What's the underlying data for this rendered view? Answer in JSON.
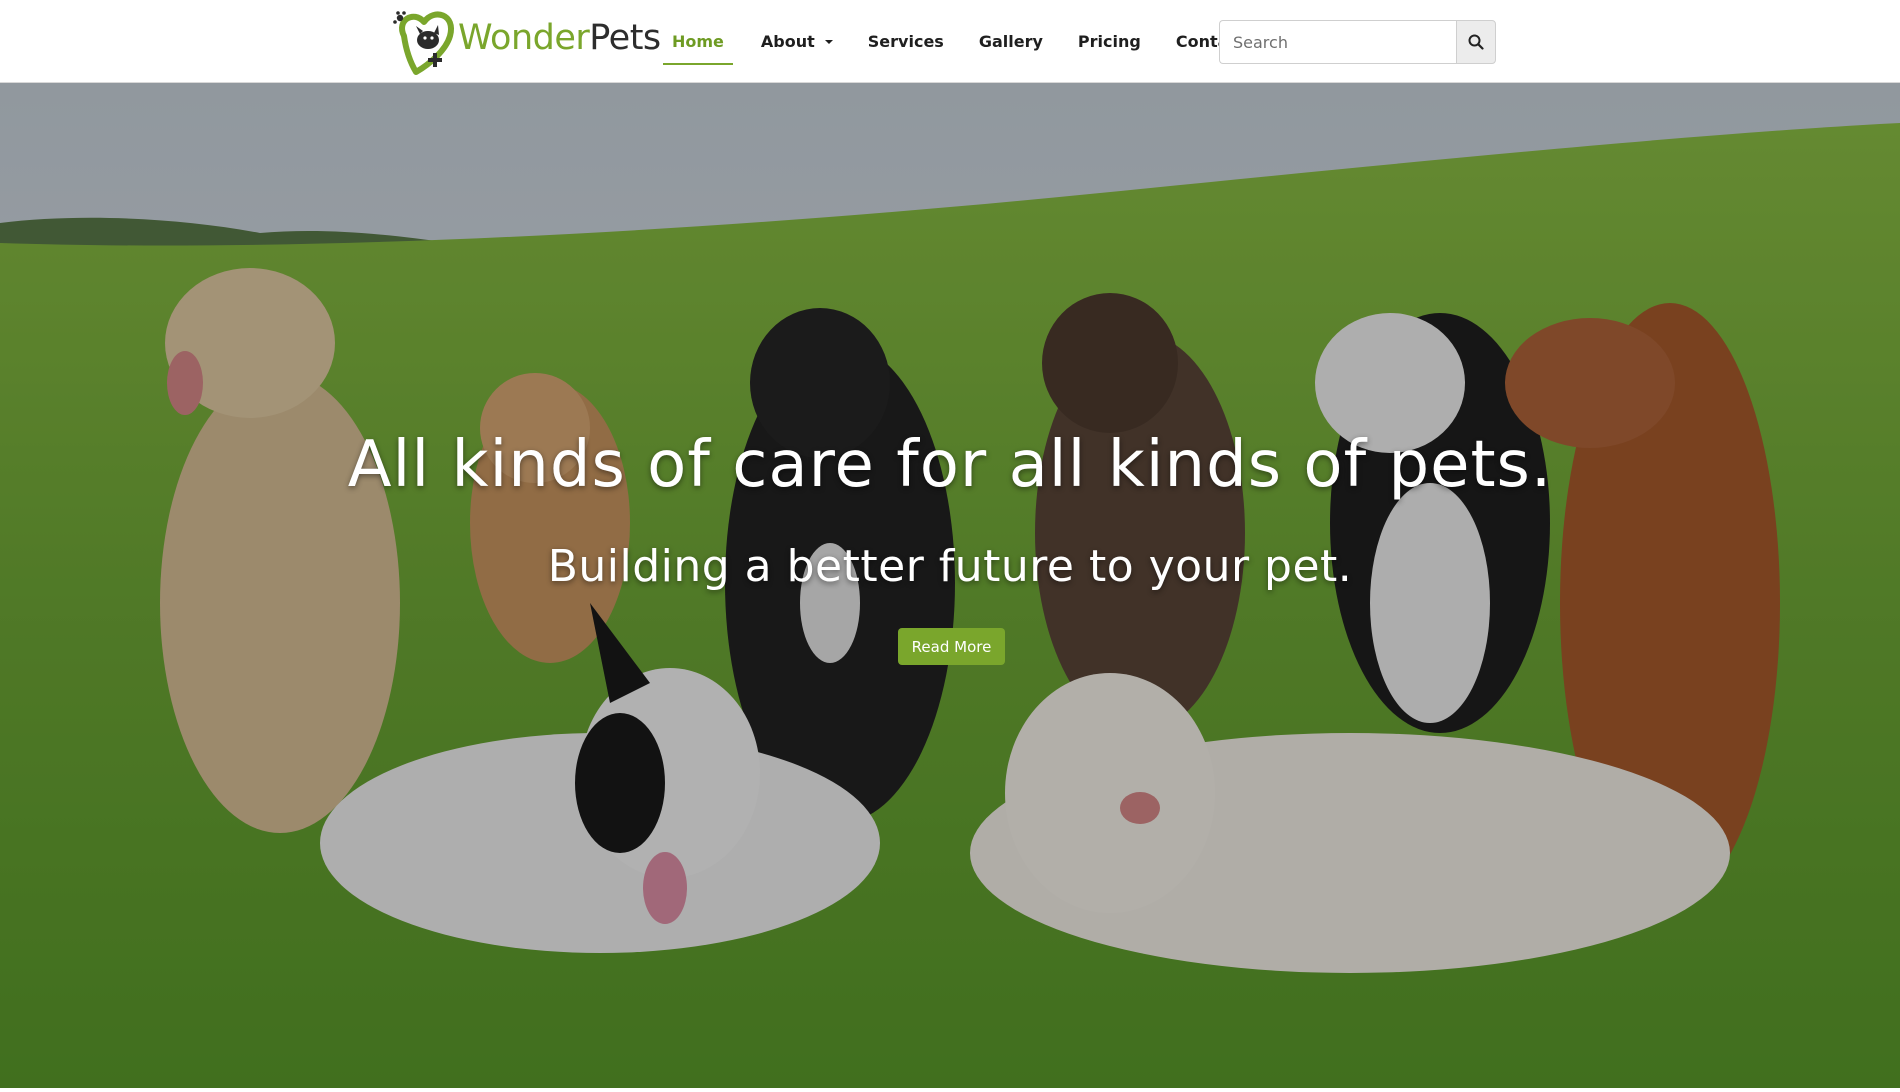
{
  "brand": {
    "name_part1": "Wonder",
    "name_part2": "Pets",
    "logo_icon": "paw-heart-cross-icon"
  },
  "nav": {
    "items": [
      {
        "label": "Home",
        "active": true
      },
      {
        "label": "About",
        "dropdown": true
      },
      {
        "label": "Services"
      },
      {
        "label": "Gallery"
      },
      {
        "label": "Pricing"
      },
      {
        "label": "Contact"
      }
    ]
  },
  "search": {
    "placeholder": "Search",
    "value": "",
    "icon": "search-icon"
  },
  "hero": {
    "heading": "All kinds of care for all kinds of pets.",
    "subheading": "Building a better future to your pet.",
    "cta_label": "Read More"
  },
  "colors": {
    "brand_green": "#7aa62c",
    "active_nav": "#6e9b23",
    "text_dark": "#1f1f1f"
  }
}
